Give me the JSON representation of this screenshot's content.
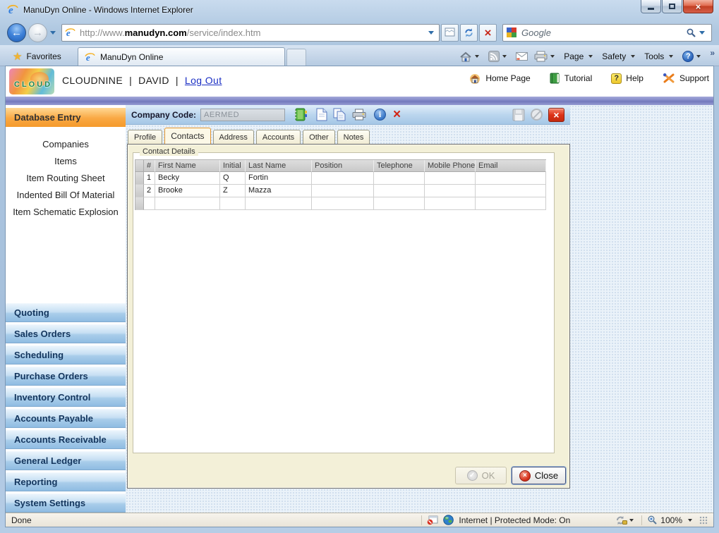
{
  "window": {
    "title": "ManuDyn Online - Windows Internet Explorer"
  },
  "browser": {
    "url_prefix": "http://www.",
    "url_domain": "manudyn.com",
    "url_path": "/service/index.htm",
    "search_placeholder": "Google",
    "favorites_label": "Favorites",
    "tab_title": "ManuDyn Online",
    "menu_page": "Page",
    "menu_safety": "Safety",
    "menu_tools": "Tools"
  },
  "app_header": {
    "logo_text": "CLOUD",
    "account_name": "CLOUDNINE",
    "separator": "|",
    "user_name": "DAVID",
    "logout_label": "Log Out",
    "home_label": "Home Page",
    "tutorial_label": "Tutorial",
    "help_label": "Help",
    "support_label": "Support"
  },
  "sidebar": {
    "section_title": "Database Entry",
    "items": [
      {
        "label": "Companies"
      },
      {
        "label": "Items"
      },
      {
        "label": "Item Routing Sheet"
      },
      {
        "label": "Indented Bill Of Material"
      },
      {
        "label": "Item Schematic Explosion"
      }
    ],
    "modules": [
      {
        "label": "Quoting"
      },
      {
        "label": "Sales Orders"
      },
      {
        "label": "Scheduling"
      },
      {
        "label": "Purchase Orders"
      },
      {
        "label": "Inventory Control"
      },
      {
        "label": "Accounts Payable"
      },
      {
        "label": "Accounts Receivable"
      },
      {
        "label": "General Ledger"
      },
      {
        "label": "Reporting"
      },
      {
        "label": "System Settings"
      }
    ]
  },
  "toolbar": {
    "company_code_label": "Company Code:",
    "company_code_value": "AERMED"
  },
  "tabs": [
    {
      "label": "Profile"
    },
    {
      "label": "Contacts"
    },
    {
      "label": "Address"
    },
    {
      "label": "Accounts"
    },
    {
      "label": "Other"
    },
    {
      "label": "Notes"
    }
  ],
  "active_tab": "Contacts",
  "contact_details": {
    "legend": "Contact Details",
    "columns": [
      "#",
      "First Name",
      "Initial",
      "Last Name",
      "Position",
      "Telephone",
      "Mobile Phone",
      "Email"
    ],
    "rows": [
      [
        "1",
        "Becky",
        "Q",
        "Fortin",
        "",
        "",
        "",
        ""
      ],
      [
        "2",
        "Brooke",
        "Z",
        "Mazza",
        "",
        "",
        "",
        ""
      ],
      [
        "",
        "",
        "",
        "",
        "",
        "",
        "",
        ""
      ]
    ]
  },
  "panel_buttons": {
    "ok_label": "OK",
    "close_label": "Close"
  },
  "status_bar": {
    "status_text": "Done",
    "zone_text": "Internet | Protected Mode: On",
    "zoom_level": "100%"
  },
  "icons": {
    "close_glyph": "×",
    "back_glyph": "←",
    "forward_glyph": "→",
    "stop_glyph": "×",
    "delete_glyph": "×",
    "star_glyph": "★",
    "overflow_glyph": "»",
    "check_glyph": "✓",
    "info_glyph": "i",
    "help_glyph": "?",
    "ie_glyph": "e"
  },
  "colors": {
    "active_section_orange": "#F7A540",
    "module_button_blue": "#9CC3E8",
    "close_red": "#D9402A",
    "link_blue": "#1B2FC4"
  }
}
